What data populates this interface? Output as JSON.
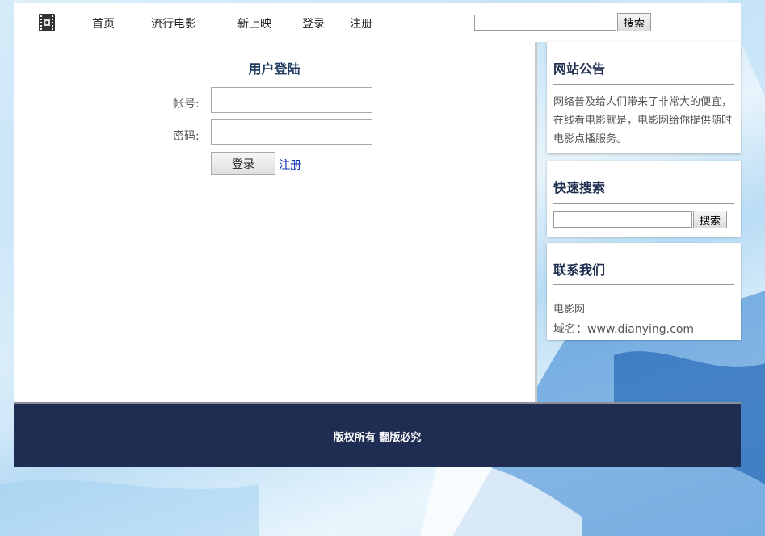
{
  "nav": {
    "items": [
      {
        "label": "首页"
      },
      {
        "label": "流行电影"
      },
      {
        "label": "新上映"
      },
      {
        "label": "登录"
      },
      {
        "label": "注册"
      }
    ],
    "search_value": "",
    "search_button": "搜索"
  },
  "login": {
    "title": "用户登陆",
    "account_label": "帐号:",
    "account_value": "",
    "password_label": "密码:",
    "password_value": "",
    "submit_label": "登录",
    "register_link": "注册"
  },
  "sidebar": {
    "announcement": {
      "title": "网站公告",
      "body": "网络普及给人们带来了非常大的便宜，在线看电影就是，电影网给你提供随时电影点播服务。"
    },
    "quick_search": {
      "title": "快速搜索",
      "value": "",
      "button": "搜索"
    },
    "contact": {
      "title": "联系我们",
      "name": "电影网",
      "domain": "域名：www.dianying.com"
    }
  },
  "footer": {
    "text": "版权所有 翻版必究"
  },
  "colors": {
    "footer_bg": "#1f2d52",
    "title_text": "#1f3a5f",
    "link": "#0b2fb8"
  },
  "icons": {
    "logo": "film-reel-icon"
  }
}
